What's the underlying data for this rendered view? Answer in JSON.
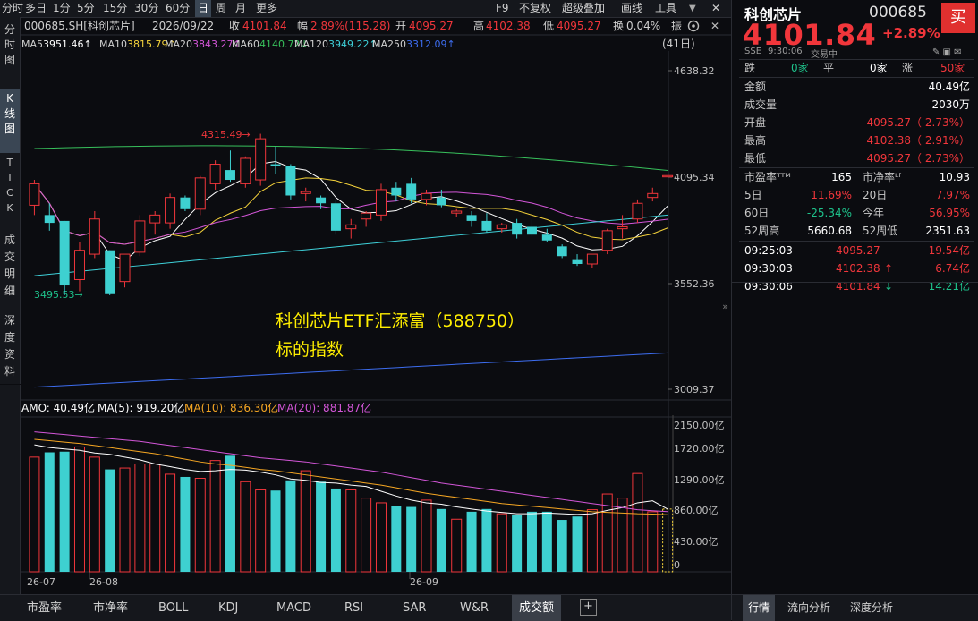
{
  "toolbar": {
    "periods": [
      "分时",
      "多日",
      "1分",
      "5分",
      "15分",
      "30分",
      "60分",
      "日",
      "周",
      "月",
      "更多"
    ],
    "active_period": "日",
    "code_name": "000685.SH[科创芯片]",
    "date": "2026/09/22",
    "close_label": "收",
    "close": "4101.84",
    "change_label": "幅",
    "change": "2.89%(115.28)",
    "open_label": "开",
    "open": "4095.27",
    "high_label": "高",
    "high": "4102.38",
    "low_label": "低",
    "low": "4095.27",
    "turnover_label": "换",
    "turnover": "0.04%",
    "amp_label": "振",
    "f9": "F9",
    "adjust": "不复权",
    "overlay": "超级叠加",
    "draw": "画线",
    "tools": "工具"
  },
  "leftnav": [
    "分时图",
    "K线图",
    "TICK",
    "成交明细",
    "深度资料"
  ],
  "ma_legend": [
    {
      "label": "MA5",
      "value": "3951.46↑",
      "color": "#ffffff"
    },
    {
      "label": "MA10",
      "value": "3815.79↑",
      "color": "#f5d33b"
    },
    {
      "label": "MA20",
      "value": "3843.27↑",
      "color": "#d356d8"
    },
    {
      "label": "MA60",
      "value": "4140.72↓",
      "color": "#38c15c"
    },
    {
      "label": "MA120",
      "value": "3949.22↑",
      "color": "#3ed0d8"
    },
    {
      "label": "MA250",
      "value": "3312.09↑",
      "color": "#3d6df0"
    }
  ],
  "days_label": "(41日)",
  "price_axis": [
    "4638.32",
    "4095.34",
    "3552.36",
    "3009.37"
  ],
  "max_annotation": "4315.49→",
  "min_annotation": "3495.53→",
  "overlay_text_1": "科创芯片ETF汇添富（588750）",
  "overlay_text_2": "标的指数",
  "amo_legend": {
    "amo": "AMO: 40.49亿",
    "ma5": "MA(5): 919.20亿",
    "ma10": "MA(10): 836.30亿",
    "ma20": "MA(20): 881.87亿"
  },
  "volume_axis": [
    "2150.00亿",
    "1720.00亿",
    "1290.00亿",
    "860.00亿",
    "430.00亿",
    "0"
  ],
  "date_axis": [
    "26-07",
    "26-08",
    "26-09"
  ],
  "chart_data": [
    {
      "type": "candlestick",
      "title": "000685.SH 科创芯片 日K",
      "ylim": [
        3009.37,
        4638.32
      ],
      "ohlc": [
        [
          3950,
          4080,
          3900,
          4060
        ],
        [
          3900,
          3960,
          3820,
          3860
        ],
        [
          3870,
          3870,
          3490,
          3540
        ],
        [
          3570,
          3760,
          3510,
          3720
        ],
        [
          3700,
          3920,
          3680,
          3880
        ],
        [
          3720,
          3720,
          3490,
          3495.53
        ],
        [
          3560,
          3700,
          3530,
          3700
        ],
        [
          3710,
          3900,
          3690,
          3870
        ],
        [
          3860,
          3920,
          3800,
          3900
        ],
        [
          3860,
          4010,
          3830,
          3990
        ],
        [
          3990,
          4000,
          3920,
          3930
        ],
        [
          3930,
          4100,
          3900,
          4090
        ],
        [
          4060,
          4180,
          4030,
          4160
        ],
        [
          4130,
          4230,
          4070,
          4080
        ],
        [
          4060,
          4200,
          4040,
          4190
        ],
        [
          4080,
          4315.49,
          4050,
          4290
        ],
        [
          4160,
          4250,
          4110,
          4150
        ],
        [
          4150,
          4160,
          3980,
          4000
        ],
        [
          4010,
          4040,
          3970,
          4020
        ],
        [
          3990,
          4000,
          3930,
          3960
        ],
        [
          3960,
          3980,
          3800,
          3820
        ],
        [
          3830,
          3880,
          3780,
          3850
        ],
        [
          3880,
          3920,
          3840,
          3910
        ],
        [
          3900,
          4060,
          3870,
          4030
        ],
        [
          4040,
          4070,
          3970,
          4000
        ],
        [
          4060,
          4090,
          3960,
          3980
        ],
        [
          3980,
          4030,
          3950,
          4010
        ],
        [
          3990,
          4030,
          3940,
          3950
        ],
        [
          3910,
          3930,
          3890,
          3920
        ],
        [
          3900,
          3920,
          3840,
          3870
        ],
        [
          3870,
          3910,
          3810,
          3820
        ],
        [
          3830,
          3860,
          3810,
          3850
        ],
        [
          3860,
          3880,
          3780,
          3800
        ],
        [
          3840,
          3880,
          3790,
          3800
        ],
        [
          3800,
          3830,
          3760,
          3770
        ],
        [
          3740,
          3750,
          3680,
          3690
        ],
        [
          3670,
          3700,
          3640,
          3650
        ],
        [
          3650,
          3700,
          3630,
          3700
        ],
        [
          3720,
          3830,
          3700,
          3820
        ],
        [
          3830,
          3900,
          3780,
          3840
        ],
        [
          3880,
          3980,
          3860,
          3960
        ],
        [
          3990,
          4040,
          3970,
          4010
        ],
        [
          4095.27,
          4102.38,
          4095.27,
          4101.84
        ]
      ],
      "volume": [
        1680,
        1750,
        1760,
        1830,
        1680,
        1500,
        1520,
        1580,
        1580,
        1430,
        1390,
        1370,
        1630,
        1700,
        1320,
        1200,
        1190,
        1340,
        1480,
        1320,
        1220,
        1200,
        1080,
        1010,
        960,
        950,
        1050,
        920,
        770,
        880,
        920,
        850,
        830,
        880,
        880,
        760,
        810,
        910,
        1140,
        1080,
        1440,
        880,
        40.49
      ],
      "ma5_amo": [
        1860,
        1820,
        1800,
        1780,
        1740,
        1720,
        1680,
        1640,
        1580,
        1540,
        1500,
        1470,
        1480,
        1500,
        1490,
        1460,
        1420,
        1360,
        1340,
        1310,
        1300,
        1270,
        1250,
        1180,
        1110,
        1050,
        1010,
        990,
        950,
        920,
        890,
        870,
        850,
        850,
        860,
        850,
        840,
        850,
        900,
        940,
        1010,
        1040,
        919.2
      ],
      "ma10_amo": [
        1940,
        1920,
        1900,
        1880,
        1850,
        1820,
        1790,
        1760,
        1730,
        1690,
        1650,
        1610,
        1580,
        1560,
        1530,
        1500,
        1480,
        1450,
        1420,
        1390,
        1360,
        1330,
        1300,
        1270,
        1230,
        1190,
        1150,
        1120,
        1090,
        1060,
        1030,
        1000,
        980,
        960,
        940,
        920,
        900,
        880,
        870,
        860,
        850,
        845,
        836.3
      ],
      "ma20_amo": [
        2050,
        2030,
        2010,
        1990,
        1970,
        1950,
        1930,
        1910,
        1880,
        1850,
        1820,
        1790,
        1760,
        1730,
        1700,
        1670,
        1650,
        1630,
        1610,
        1580,
        1550,
        1520,
        1490,
        1460,
        1420,
        1380,
        1340,
        1300,
        1270,
        1240,
        1210,
        1180,
        1150,
        1120,
        1090,
        1060,
        1030,
        1000,
        970,
        940,
        910,
        895,
        881.87
      ]
    }
  ],
  "bottom_tabs": [
    "市盈率",
    "市净率",
    "BOLL",
    "KDJ",
    "MACD",
    "RSI",
    "SAR",
    "W&R",
    "成交额"
  ],
  "active_bottom_tab": "成交额",
  "quote": {
    "name": "科创芯片",
    "code": "000685",
    "buy_label": "买",
    "price": "4101.84",
    "change_pct": "+2.89%",
    "market": "SSE",
    "time": "9:30:06",
    "status": "交易中",
    "fall_label": "跌",
    "fall_count": "0家",
    "flat_label": "平",
    "flat_count": "0家",
    "rise_label": "涨",
    "rise_count": "50家",
    "rows": [
      {
        "label": "金额",
        "value": "40.49亿",
        "cls": "white"
      },
      {
        "label": "成交量",
        "value": "2030万",
        "cls": "white"
      },
      {
        "label": "开盘",
        "value": "4095.27（ 2.73%）",
        "cls": "red"
      },
      {
        "label": "最高",
        "value": "4102.38（ 2.91%）",
        "cls": "red"
      },
      {
        "label": "最低",
        "value": "4095.27（ 2.73%）",
        "cls": "red"
      }
    ],
    "stats": [
      {
        "l1": "市盈率ᵀᵀᴹ",
        "v1": "165",
        "c1": "white",
        "l2": "市净率ᴸᶠ",
        "v2": "10.93",
        "c2": "white"
      },
      {
        "l1": "5日",
        "v1": "11.69%",
        "c1": "red",
        "l2": "20日",
        "v2": "7.97%",
        "c2": "red"
      },
      {
        "l1": "60日",
        "v1": "-25.34%",
        "c1": "green",
        "l2": "今年",
        "v2": "56.95%",
        "c2": "red"
      },
      {
        "l1": "52周高",
        "v1": "5660.68",
        "c1": "white",
        "l2": "52周低",
        "v2": "2351.63",
        "c2": "white"
      }
    ],
    "ticks": [
      {
        "time": "09:25:03",
        "price": "4095.27",
        "arrow": "",
        "amount": "19.54亿",
        "acls": "red"
      },
      {
        "time": "09:30:03",
        "price": "4102.38",
        "arrow": "↑",
        "amount": "6.74亿",
        "acls": "red"
      },
      {
        "time": "09:30:06",
        "price": "4101.84",
        "arrow": "↓",
        "amount": "14.21亿",
        "acls": "green"
      }
    ],
    "tabs": [
      "行情",
      "流向分析",
      "深度分析"
    ],
    "active_tab": "行情"
  }
}
